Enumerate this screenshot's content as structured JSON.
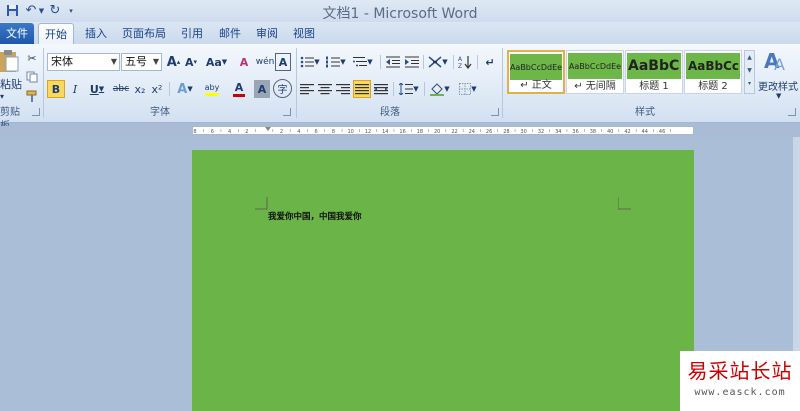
{
  "window": {
    "title": "文档1 - Microsoft Word",
    "qat": {
      "save_icon": "save-icon",
      "undo_icon": "undo-icon",
      "redo_icon": "redo-icon",
      "customize_icon": "customize-qat-icon"
    }
  },
  "tabs": [
    {
      "label": "文件"
    },
    {
      "label": "开始"
    },
    {
      "label": "插入"
    },
    {
      "label": "页面布局"
    },
    {
      "label": "引用"
    },
    {
      "label": "邮件"
    },
    {
      "label": "审阅"
    },
    {
      "label": "视图"
    }
  ],
  "ribbon": {
    "clipboard": {
      "paste_label": "粘贴",
      "group_label": "剪贴板"
    },
    "font": {
      "group_label": "字体",
      "font_name": "宋体",
      "font_size": "五号",
      "grow": "A",
      "shrink": "A",
      "change_case": "Aa",
      "clear": "A",
      "wen": "wén",
      "char_border": "A",
      "bold": "B",
      "italic": "I",
      "underline": "U",
      "strike": "abc",
      "subscript": "x₂",
      "superscript": "x²",
      "text_effect": "A",
      "highlight": "aby",
      "font_color": "A",
      "char_shading": "A",
      "enclose": "字",
      "colors": {
        "highlight": "#ffff00",
        "font_color": "#d00000"
      }
    },
    "paragraph": {
      "group_label": "段落"
    },
    "styles": {
      "group_label": "样式",
      "items": [
        {
          "sample": "AaBbCcDdEe",
          "name": "↵ 正文"
        },
        {
          "sample": "AaBbCcDdEe",
          "name": "↵ 无间隔"
        },
        {
          "sample": "AaBbC",
          "name": "标题 1"
        },
        {
          "sample": "AaBbCcI",
          "name": "标题 2"
        }
      ],
      "change_styles_label": "更改样式"
    }
  },
  "ruler": {
    "ticks": [
      "8",
      "6",
      "4",
      "2",
      "",
      "2",
      "4",
      "6",
      "8",
      "10",
      "12",
      "14",
      "16",
      "18",
      "20",
      "22",
      "24",
      "26",
      "28",
      "30",
      "32",
      "34",
      "36",
      "38",
      "40",
      "42",
      "44",
      "46"
    ]
  },
  "document": {
    "text": "我爱你中国，中国我爱你",
    "page_color": "#6bb448"
  },
  "watermark": {
    "title": "易采站长站",
    "url": "www.easck.com"
  }
}
